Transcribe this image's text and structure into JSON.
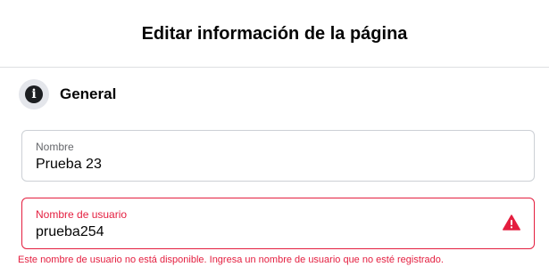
{
  "header": {
    "title": "Editar información de la página"
  },
  "section": {
    "title": "General",
    "icon": "info-icon"
  },
  "fields": {
    "name": {
      "label": "Nombre",
      "value": "Prueba 23"
    },
    "username": {
      "label": "Nombre de usuario",
      "value": "prueba254",
      "status_icon": "warning-icon",
      "error": "Este nombre de usuario no está disponible. Ingresa un nombre de usuario que no esté registrado."
    }
  },
  "colors": {
    "error": "#e41e3f",
    "border": "#ccd0d5",
    "icon_bg": "#e4e6eb"
  }
}
